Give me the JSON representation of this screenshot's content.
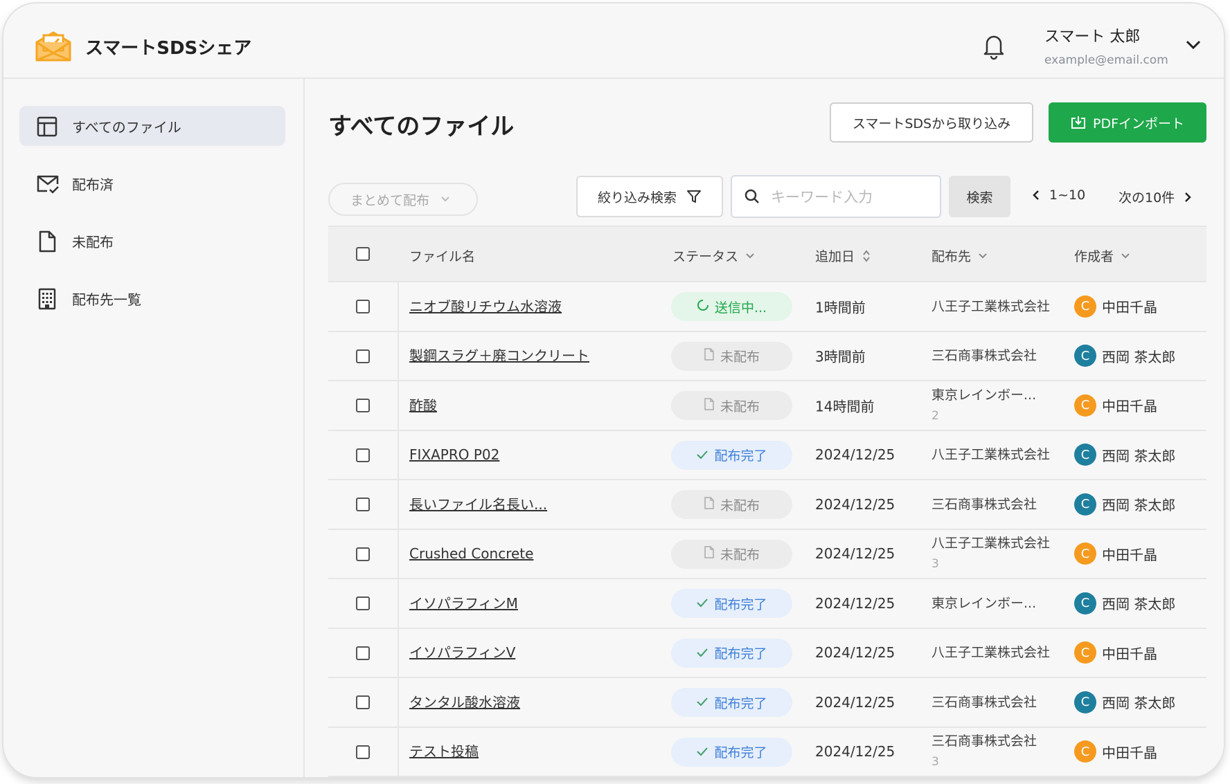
{
  "app": {
    "name": "スマートSDSシェア"
  },
  "user": {
    "name": "スマート 太郎",
    "email": "example@email.com"
  },
  "sidebar": {
    "items": [
      {
        "label": "すべてのファイル",
        "icon": "layout-icon",
        "active": true
      },
      {
        "label": "配布済",
        "icon": "mail-check-icon",
        "active": false
      },
      {
        "label": "未配布",
        "icon": "file-icon",
        "active": false
      },
      {
        "label": "配布先一覧",
        "icon": "building-icon",
        "active": false
      }
    ]
  },
  "main": {
    "title": "すべてのファイル",
    "import_button": "スマートSDSから取り込み",
    "pdf_button": "PDFインポート",
    "bulk_distribute": "まとめて配布",
    "filter_button": "絞り込み検索",
    "search_placeholder": "キーワード入力",
    "search_button": "検索",
    "pager_range": "1~10",
    "pager_next": "次の10件"
  },
  "table": {
    "headers": {
      "name": "ファイル名",
      "status": "ステータス",
      "added": "追加日",
      "destination": "配布先",
      "author": "作成者"
    },
    "rows": [
      {
        "name": "ニオブ酸リチウム水溶液",
        "status": "送信中...",
        "status_type": "sending",
        "added": "1時間前",
        "dest": "八王子工業株式会社",
        "dest_extra": "",
        "author": "中田千晶",
        "avatar": "C",
        "avatar_color": "orange"
      },
      {
        "name": "製鋼スラグ＋廃コンクリート",
        "status": "未配布",
        "status_type": "undist",
        "added": "3時間前",
        "dest": "三石商事株式会社",
        "dest_extra": "",
        "author": "西岡 茶太郎",
        "avatar": "C",
        "avatar_color": "teal"
      },
      {
        "name": "酢酸",
        "status": "未配布",
        "status_type": "undist",
        "added": "14時間前",
        "dest": "東京レインボー...",
        "dest_extra": "2",
        "author": "中田千晶",
        "avatar": "C",
        "avatar_color": "orange"
      },
      {
        "name": "FIXAPRO P02",
        "status": "配布完了",
        "status_type": "done",
        "added": "2024/12/25",
        "dest": "八王子工業株式会社",
        "dest_extra": "",
        "author": "西岡 茶太郎",
        "avatar": "C",
        "avatar_color": "teal"
      },
      {
        "name": "長いファイル名長い...",
        "status": "未配布",
        "status_type": "undist",
        "added": "2024/12/25",
        "dest": "三石商事株式会社",
        "dest_extra": "",
        "author": "西岡 茶太郎",
        "avatar": "C",
        "avatar_color": "teal"
      },
      {
        "name": "Crushed Concrete",
        "status": "未配布",
        "status_type": "undist",
        "added": "2024/12/25",
        "dest": "八王子工業株式会社",
        "dest_extra": "3",
        "author": "中田千晶",
        "avatar": "C",
        "avatar_color": "orange"
      },
      {
        "name": "イソパラフィンM",
        "status": "配布完了",
        "status_type": "done",
        "added": "2024/12/25",
        "dest": "東京レインボー...",
        "dest_extra": "",
        "author": "西岡 茶太郎",
        "avatar": "C",
        "avatar_color": "teal"
      },
      {
        "name": "イソパラフィンV",
        "status": "配布完了",
        "status_type": "done",
        "added": "2024/12/25",
        "dest": "八王子工業株式会社",
        "dest_extra": "",
        "author": "中田千晶",
        "avatar": "C",
        "avatar_color": "orange"
      },
      {
        "name": "タンタル酸水溶液",
        "status": "配布完了",
        "status_type": "done",
        "added": "2024/12/25",
        "dest": "三石商事株式会社",
        "dest_extra": "",
        "author": "西岡 茶太郎",
        "avatar": "C",
        "avatar_color": "teal"
      },
      {
        "name": "テスト投稿",
        "status": "配布完了",
        "status_type": "done",
        "added": "2024/12/25",
        "dest": "三石商事株式会社",
        "dest_extra": "3",
        "author": "中田千晶",
        "avatar": "C",
        "avatar_color": "orange"
      }
    ]
  },
  "colors": {
    "brand": "#f5a623",
    "primary": "#1fa84b",
    "done": "#3f7fd8"
  }
}
